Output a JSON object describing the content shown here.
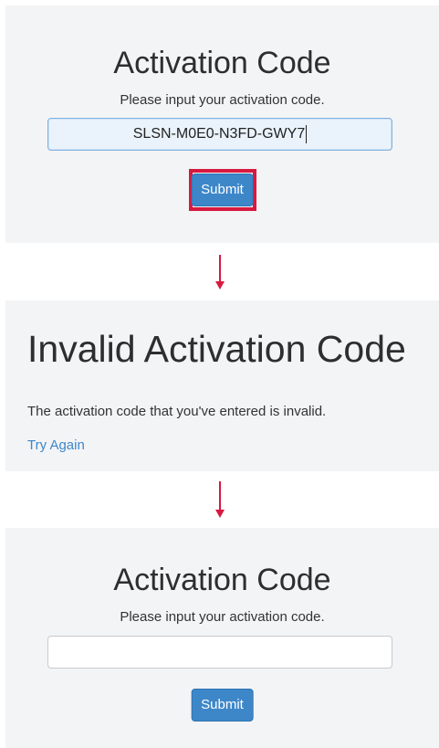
{
  "step1": {
    "title": "Activation Code",
    "subtitle": "Please input your activation code.",
    "input_value": "SLSN-M0E0-N3FD-GWY7",
    "submit_label": "Submit"
  },
  "step2": {
    "title": "Invalid Activation Code",
    "message": "The activation code that you've entered is invalid.",
    "link_label": "Try Again"
  },
  "step3": {
    "title": "Activation Code",
    "subtitle": "Please input your activation code.",
    "input_value": "",
    "submit_label": "Submit"
  },
  "colors": {
    "highlight": "#d8193f",
    "button": "#3d87c9",
    "link": "#3d87c9",
    "panel_background": "#f3f4f6"
  },
  "icons": {
    "step_arrow": "arrow-down-icon"
  }
}
